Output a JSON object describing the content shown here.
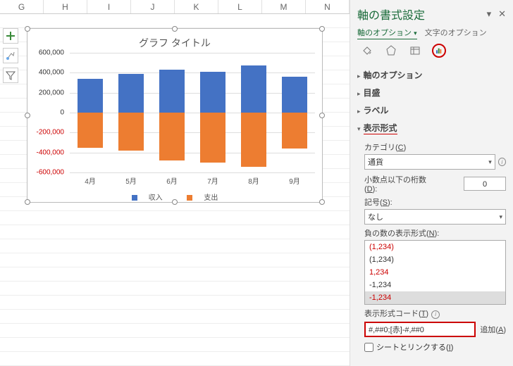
{
  "columns": [
    "G",
    "H",
    "I",
    "J",
    "K",
    "L",
    "M",
    "N"
  ],
  "chart": {
    "title": "グラフ タイトル",
    "legend": {
      "s1": "収入",
      "s2": "支出"
    }
  },
  "chart_data": {
    "type": "bar",
    "categories": [
      "4月",
      "5月",
      "6月",
      "7月",
      "8月",
      "9月"
    ],
    "series": [
      {
        "name": "収入",
        "values": [
          340000,
          390000,
          430000,
          410000,
          470000,
          360000
        ],
        "color": "#4472c4"
      },
      {
        "name": "支出",
        "values": [
          -350000,
          -380000,
          -480000,
          -500000,
          -540000,
          -360000
        ],
        "color": "#ed7d31"
      }
    ],
    "ylim": [
      -600000,
      600000
    ],
    "yticks": [
      600000,
      400000,
      200000,
      0,
      -200000,
      -400000,
      -600000
    ],
    "ylabels": [
      "600,000",
      "400,000",
      "200,000",
      "0",
      "-200,000",
      "-400,000",
      "-600,000"
    ]
  },
  "panel": {
    "title": "軸の書式設定",
    "tab1": "軸のオプション",
    "tab2": "文字のオプション",
    "sec_axis": "軸のオプション",
    "sec_tick": "目盛",
    "sec_label": "ラベル",
    "sec_format": "表示形式",
    "category_label": "カテゴリ",
    "category_key": "C",
    "category_value": "通貨",
    "decimals_label": "小数点以下の桁数",
    "decimals_key": "D",
    "decimals_value": "0",
    "symbol_label": "記号",
    "symbol_key": "S",
    "symbol_value": "なし",
    "neg_label": "負の数の表示形式",
    "neg_key": "N",
    "neg_options": [
      {
        "text": "(1,234)",
        "red": true
      },
      {
        "text": "(1,234)",
        "red": false
      },
      {
        "text": "1,234",
        "red": true
      },
      {
        "text": "-1,234",
        "red": false
      },
      {
        "text": "-1,234",
        "red": true,
        "selected": true
      }
    ],
    "code_label": "表示形式コード",
    "code_key": "T",
    "code_value": "#,##0;[赤]-#,##0",
    "add_label": "追加",
    "add_key": "A",
    "link_label": "シートとリンクする",
    "link_key": "I"
  }
}
